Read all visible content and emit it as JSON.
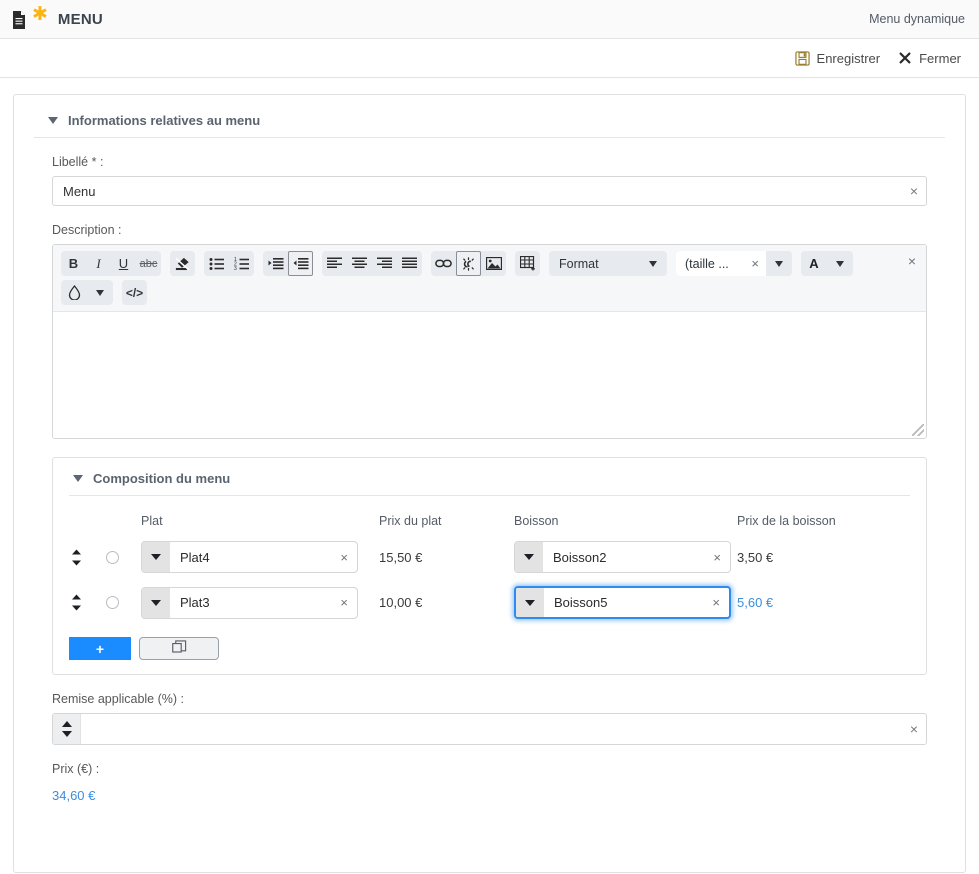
{
  "topbar": {
    "doc_icon": "document-icon",
    "star_icon": "star-icon",
    "title": "MENU",
    "context_label": "Menu dynamique"
  },
  "actionbar": {
    "save_label": "Enregistrer",
    "save_icon": "floppy-disk-icon",
    "close_label": "Fermer",
    "close_icon": "close-x-icon"
  },
  "section": {
    "title": "Informations relatives au menu"
  },
  "libelle": {
    "label": "Libellé * :",
    "value": "Menu",
    "placeholder": "",
    "clear": "×"
  },
  "description": {
    "label": "Description :",
    "value": "",
    "toolbar": {
      "bold": "B",
      "italic": "I",
      "underline": "U",
      "strike": "abc",
      "remove_format": "remove-format-icon",
      "bullet_list": "bulleted-list-icon",
      "numbered_list": "numbered-list-icon",
      "indent": "indent-icon",
      "outdent": "outdent-icon",
      "align_left": "align-left-icon",
      "align_center": "align-center-icon",
      "align_right": "align-right-icon",
      "align_justify": "align-justify-icon",
      "link": "link-icon",
      "unlink": "unlink-icon",
      "image": "image-icon",
      "table": "table-icon",
      "format_label": "Format",
      "size_label": "(taille  ...",
      "size_clear": "×",
      "text_color": "A",
      "bg_color": "ink-drop-icon",
      "source": "</>",
      "close": "×"
    }
  },
  "composition": {
    "title": "Composition du menu",
    "columns": {
      "plat": "Plat",
      "prix_plat": "Prix du plat",
      "boisson": "Boisson",
      "prix_boisson": "Prix de la boisson"
    },
    "rows": [
      {
        "plat": "Plat4",
        "prix_plat": "15,50 €",
        "boisson": "Boisson2",
        "prix_boisson": "3,50 €",
        "boisson_focused": false,
        "prix_boisson_highlight": false
      },
      {
        "plat": "Plat3",
        "prix_plat": "10,00 €",
        "boisson": "Boisson5",
        "prix_boisson": "5,60 €",
        "boisson_focused": true,
        "prix_boisson_highlight": true
      }
    ],
    "add_label": "+",
    "copy_icon": "duplicate-icon",
    "clear": "×",
    "drag_icon": "drag-updown-icon"
  },
  "remise": {
    "label": "Remise applicable (%) :",
    "value": "",
    "placeholder": "",
    "clear": "×"
  },
  "prix": {
    "label": "Prix (€) :",
    "value": "34,60 €"
  },
  "colors": {
    "accent": "#1a8cff",
    "link": "#3c8dde",
    "star": "#fcb415",
    "header_text": "#5a636f"
  }
}
